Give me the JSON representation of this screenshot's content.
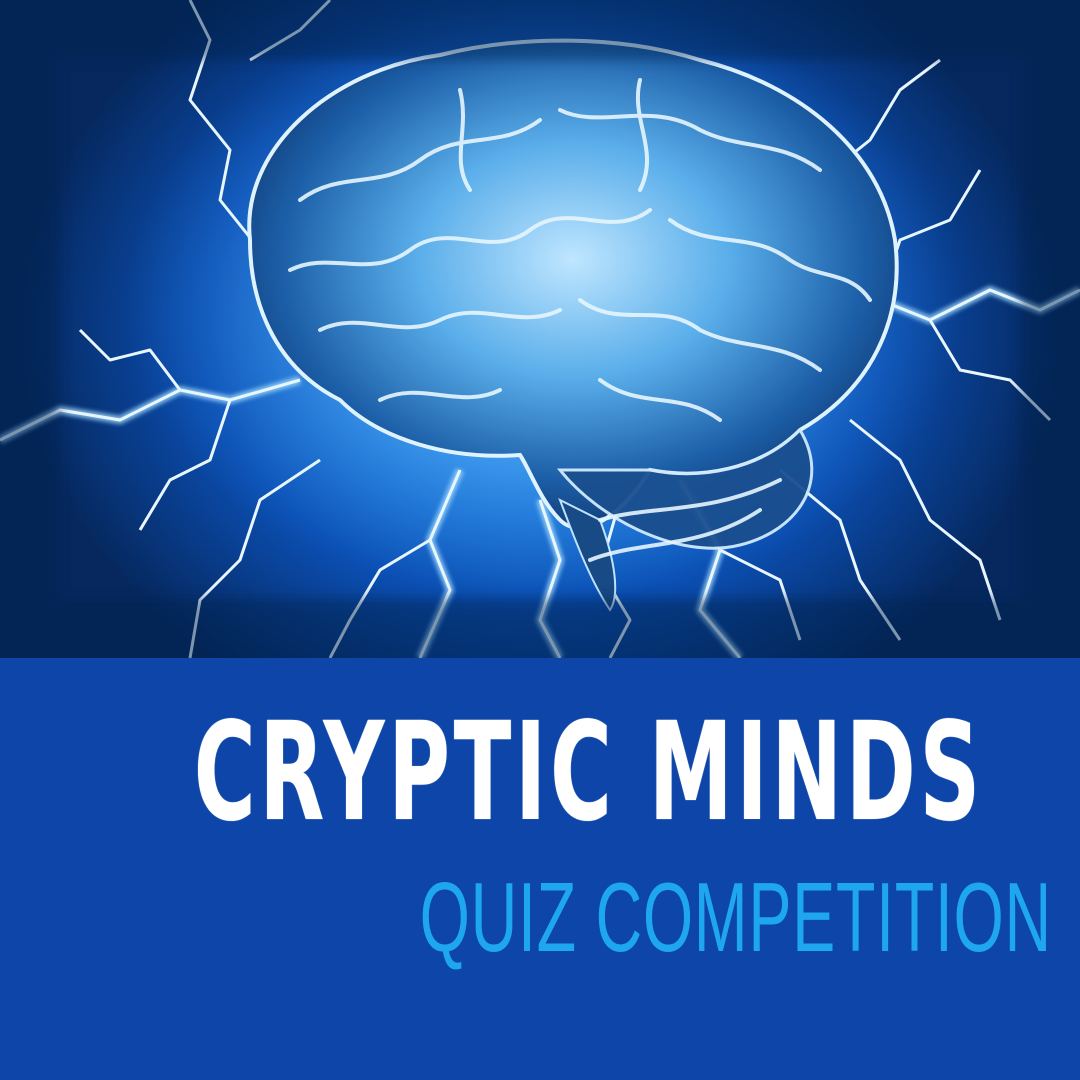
{
  "poster": {
    "title": "CRYPTIC MINDS",
    "subtitle": "QUIZ COMPETITION"
  },
  "colors": {
    "banner": "#0d45a8",
    "title": "#ffffff",
    "subtitle": "#1ea6ee",
    "glow": "#3aa8ff"
  },
  "icons": {
    "hero": "brain-lightning-icon"
  }
}
